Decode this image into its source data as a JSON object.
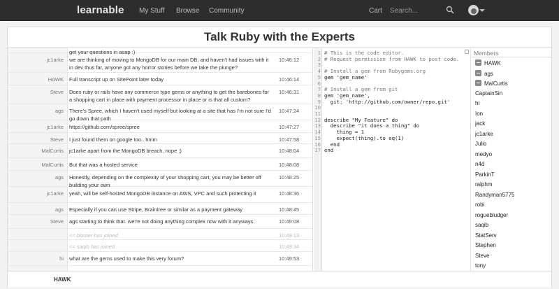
{
  "nav": {
    "logo": "learnable",
    "links": [
      "My Stuff",
      "Browse",
      "Community"
    ],
    "cart": "Cart",
    "search_placeholder": "Search..."
  },
  "page": {
    "title": "Talk Ruby with the Experts"
  },
  "chat": {
    "messages": [
      {
        "name": "",
        "text": "get your questions in asap :)",
        "time": "",
        "system": false
      },
      {
        "name": "jc1arke",
        "text": "we are thinking of moving to MongoDB for our main DB, and haven't had issues with it in dev thus far, anyone got any horror stories before we take the plunge?",
        "time": "10:46:12",
        "system": false
      },
      {
        "name": "HAWK",
        "text": "Full transcript up on SitePoint later today",
        "time": "10:46:14",
        "system": false
      },
      {
        "name": "Steve",
        "text": "Does ruby or rails have any commerce type gems or anything to get the barebones for a shopping cart in place with payment processor in place or is that all custom?",
        "time": "10:46:31",
        "system": false
      },
      {
        "name": "ags",
        "text": "There's Spree, which I haven't used myself but looking at a site that has I'm not sure I'd go down that path",
        "time": "10:47:24",
        "system": false
      },
      {
        "name": "jc1arke",
        "text": "https://github.com/spree/spree",
        "time": "10:47:27",
        "system": false
      },
      {
        "name": "Steve",
        "text": "I just found them on google too.. hmm",
        "time": "10:47:58",
        "system": false
      },
      {
        "name": "MalCurtis",
        "text": "jc1arke apart from the MongoDB breach, nope ;)",
        "time": "10:48:04",
        "system": false
      },
      {
        "name": "MalCurtis",
        "text": "But that was a hosted service",
        "time": "10:48:08",
        "system": false
      },
      {
        "name": "ags",
        "text": "Honestly, depending on the complexity of your shopping cart, you may be better off building your own",
        "time": "10:48:25",
        "system": false
      },
      {
        "name": "jc1arke",
        "text": "yeah, will be self-hosted MongoDB instance on AWS, VPC and such protecting it",
        "time": "10:48:36",
        "system": false
      },
      {
        "name": "ags",
        "text": "Especially if you can use Stripe, Braintree or similar as a payment gateway",
        "time": "10:48:45",
        "system": false
      },
      {
        "name": "Steve",
        "text": "ags starting to think that. we're not doing anything complex now with it anyways.",
        "time": "10:49:08",
        "system": false
      },
      {
        "name": "",
        "text": "<< blaster has joined",
        "time": "10:49:13",
        "system": true
      },
      {
        "name": "",
        "text": "<< saqib has joined",
        "time": "10:49:34",
        "system": true
      },
      {
        "name": "hi",
        "text": "what are the gems used to make this very forum?",
        "time": "10:49:53",
        "system": false
      }
    ]
  },
  "editor": {
    "lines": [
      "# This is the code editor.",
      "# Request permission from HAWK to post code.",
      "",
      "# Install a gem from Rubygems.org",
      "gem 'gem_name'",
      "",
      "# Install a gem from git",
      "gem 'gem_name',",
      "  git: 'http://github.com/owner/repo.git'",
      "",
      "",
      "describe \"My Feature\" do",
      "  describe \"it does a thing\" do",
      "    thing = 1",
      "    expect(thing).to eq(1)",
      "  end",
      "end"
    ]
  },
  "members": {
    "title": "Members",
    "list": [
      {
        "name": "HAWK",
        "badge": true
      },
      {
        "name": "ags",
        "badge": true
      },
      {
        "name": "MalCurtis",
        "badge": true
      },
      {
        "name": "CaptainSin",
        "badge": false
      },
      {
        "name": "hi",
        "badge": false
      },
      {
        "name": "Ion",
        "badge": false
      },
      {
        "name": "jack",
        "badge": false
      },
      {
        "name": "jc1arke",
        "badge": false
      },
      {
        "name": "Julio",
        "badge": false
      },
      {
        "name": "medyo",
        "badge": false
      },
      {
        "name": "n4d",
        "badge": false
      },
      {
        "name": "ParkinT",
        "badge": false
      },
      {
        "name": "ralphm",
        "badge": false
      },
      {
        "name": "Randyman5775",
        "badge": false
      },
      {
        "name": "robi",
        "badge": false
      },
      {
        "name": "roguebludger",
        "badge": false
      },
      {
        "name": "saqib",
        "badge": false
      },
      {
        "name": "StatServ",
        "badge": false
      },
      {
        "name": "Stephen",
        "badge": false
      },
      {
        "name": "Steve",
        "badge": false
      },
      {
        "name": "tony",
        "badge": false
      }
    ]
  },
  "footer": {
    "current_user": "HAWK",
    "input_value": ""
  }
}
